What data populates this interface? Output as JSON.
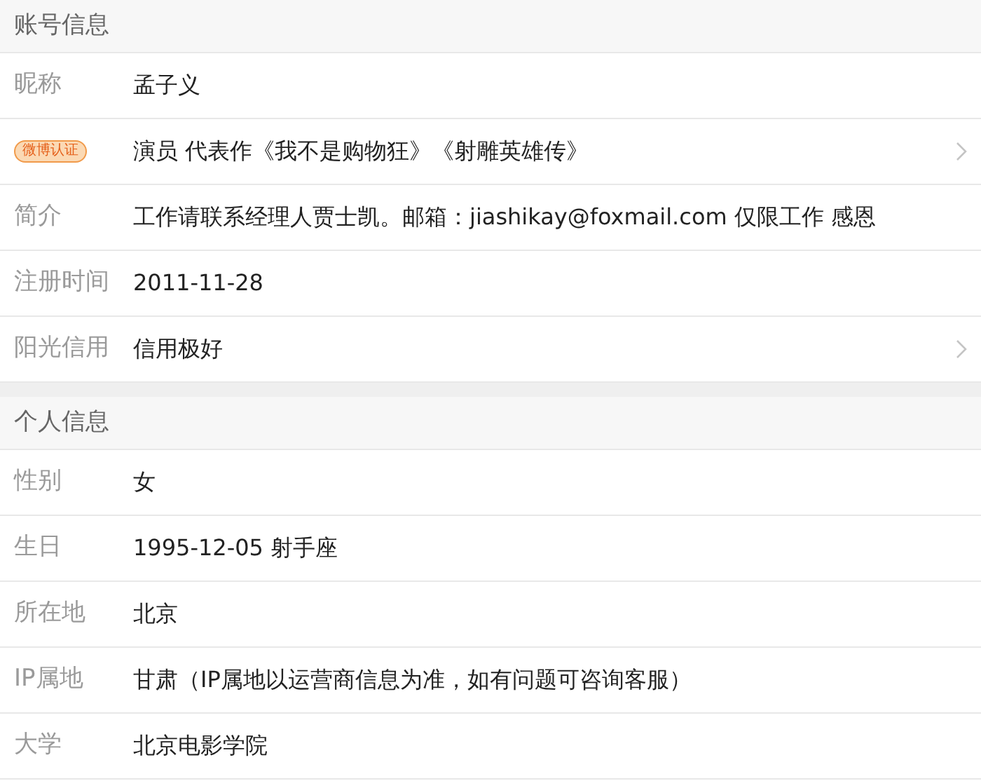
{
  "sections": [
    {
      "title": "账号信息",
      "rows": [
        {
          "label": "昵称",
          "kind": "text",
          "value": "孟子义",
          "arrow": false
        },
        {
          "label": "微博认证",
          "kind": "badge",
          "value": "演员 代表作《我不是购物狂》《射雕英雄传》",
          "arrow": true
        },
        {
          "label": "简介",
          "kind": "text",
          "value": "工作请联系经理人贾士凯。邮箱：jiashikay@foxmail.com 仅限工作 感恩",
          "arrow": false
        },
        {
          "label": "注册时间",
          "kind": "text",
          "value": "2011-11-28",
          "arrow": false
        },
        {
          "label": "阳光信用",
          "kind": "text",
          "value": "信用极好",
          "arrow": true
        }
      ]
    },
    {
      "title": "个人信息",
      "rows": [
        {
          "label": "性别",
          "kind": "text",
          "value": "女",
          "arrow": false
        },
        {
          "label": "生日",
          "kind": "text",
          "value": "1995-12-05 射手座",
          "arrow": false
        },
        {
          "label": "所在地",
          "kind": "text",
          "value": "北京",
          "arrow": false
        },
        {
          "label": "IP属地",
          "kind": "text",
          "value": "甘肃（IP属地以运营商信息为准，如有问题可咨询客服）",
          "arrow": false
        },
        {
          "label": "大学",
          "kind": "text",
          "value": "北京电影学院",
          "arrow": false
        }
      ]
    }
  ]
}
